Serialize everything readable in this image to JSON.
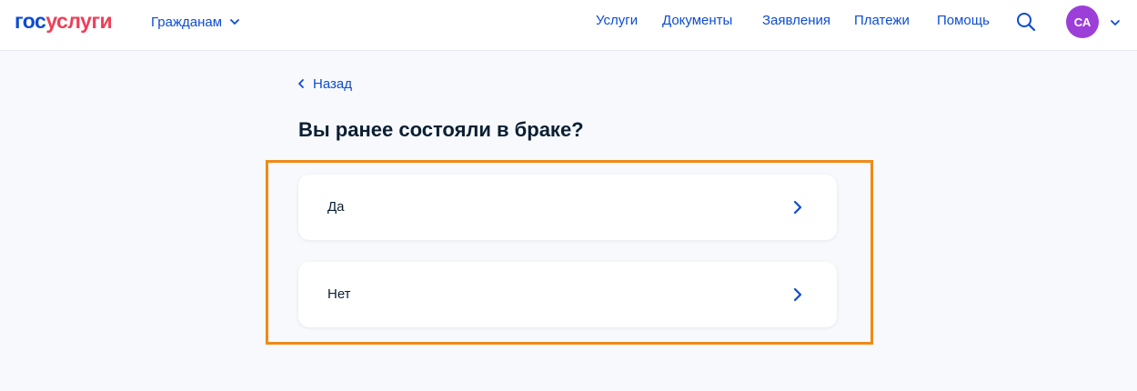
{
  "header": {
    "logo": {
      "part1": "гос",
      "part2": "услуги"
    },
    "audience_menu": "Гражданам",
    "nav": [
      "Услуги",
      "Документы",
      "Заявления",
      "Платежи",
      "Помощь"
    ],
    "avatar_initials": "СА"
  },
  "main": {
    "back_label": "Назад",
    "question": "Вы ранее состояли в браке?",
    "options": [
      "Да",
      "Нет"
    ]
  },
  "colors": {
    "brand_blue": "#0d4cd3",
    "brand_red": "#ee3f58",
    "avatar": "#9c3fd9",
    "highlight_border": "#f08a16",
    "page_bg": "#f7f9fc"
  },
  "icons": {
    "search": "search-icon",
    "dropdown": "chevron-down-icon",
    "back": "chevron-left-icon",
    "option_arrow": "chevron-right-icon"
  }
}
